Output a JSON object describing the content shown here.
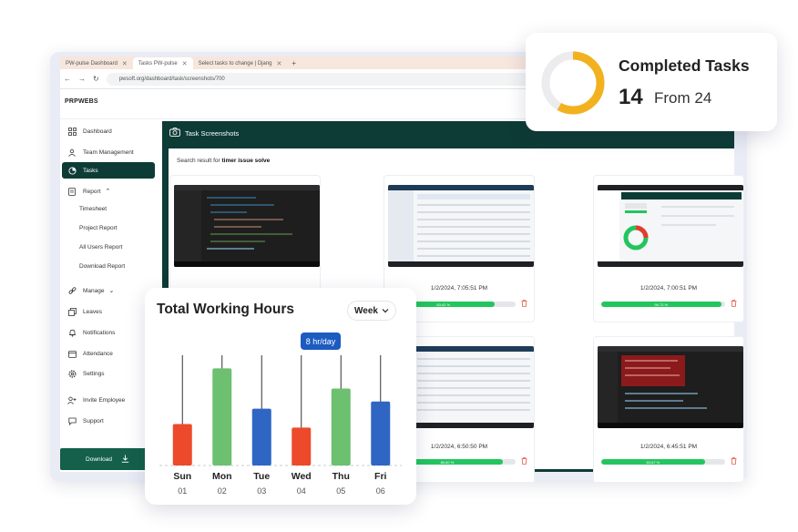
{
  "browser": {
    "tabs": [
      {
        "label": "PW-pulse Dashboard",
        "active": false
      },
      {
        "label": "Tasks PW-pulse",
        "active": true
      },
      {
        "label": "Select tasks to change | Djang",
        "active": false
      }
    ],
    "url": "pwsoft.org/dashboard/task/screenshots/700"
  },
  "app": {
    "brand": "PRPWEBS",
    "sidebar": {
      "items": [
        {
          "label": "Dashboard",
          "icon": "grid-icon"
        },
        {
          "label": "Team Management",
          "icon": "team-icon"
        },
        {
          "label": "Tasks",
          "icon": "tasks-icon",
          "active": true
        },
        {
          "label": "Report",
          "icon": "report-icon"
        },
        {
          "label": "Manage",
          "icon": "link-icon"
        },
        {
          "label": "Leaves",
          "icon": "copy-icon"
        },
        {
          "label": "Notifications",
          "icon": "bell-icon"
        },
        {
          "label": "Attendance",
          "icon": "calendar-icon"
        },
        {
          "label": "Settings",
          "icon": "gear-icon"
        },
        {
          "label": "Invite Employee",
          "icon": "add-user-icon"
        },
        {
          "label": "Support",
          "icon": "chat-icon"
        }
      ],
      "report_sub": [
        "Timesheet",
        "Project Report",
        "All Users Report",
        "Download Report"
      ],
      "download_label": "Download"
    },
    "content": {
      "title": "Task Screenshots",
      "search_prefix": "Search result for",
      "search_term": "timer issue solve",
      "cards": [
        {
          "time": "",
          "progress": "",
          "progress_value": 0,
          "theme": "dark"
        },
        {
          "time": "1/2/2024, 7:05:51 PM",
          "progress": "83.42 %",
          "progress_value": 83.42,
          "theme": "light"
        },
        {
          "time": "1/2/2024, 7:00:51 PM",
          "progress": "96.72 %",
          "progress_value": 96.72,
          "theme": "dash"
        },
        {
          "time": "",
          "progress": "",
          "progress_value": 0,
          "theme": "light"
        },
        {
          "time": "1/2/2024, 6:50:50 PM",
          "progress": "89.60 %",
          "progress_value": 89.6,
          "theme": "light"
        },
        {
          "time": "1/2/2024, 6:45:51 PM",
          "progress": "83.67 %",
          "progress_value": 83.67,
          "theme": "dark"
        }
      ]
    }
  },
  "completed_tasks": {
    "title": "Completed Tasks",
    "count": "14",
    "from_label": "From 24",
    "completed": 14,
    "total": 24,
    "ring_color": "#f2b11f",
    "track_color": "#ececee"
  },
  "working_hours": {
    "title": "Total Working Hours",
    "period_selected": "Week",
    "tooltip": "8 hr/day"
  },
  "chart_data": {
    "type": "bar",
    "title": "Total Working Hours",
    "categories": [
      "Sun",
      "Mon",
      "Tue",
      "Wed",
      "Thu",
      "Fri"
    ],
    "dates": [
      "01",
      "02",
      "03",
      "04",
      "05",
      "06"
    ],
    "values": [
      3.5,
      8.2,
      4.8,
      3.2,
      6.5,
      5.4
    ],
    "colors": [
      "#ec4a2a",
      "#6cc070",
      "#2f66c4",
      "#ec4a2a",
      "#6cc070",
      "#2f66c4"
    ],
    "ylim": [
      0,
      10
    ],
    "grid": false,
    "legend": "none"
  }
}
